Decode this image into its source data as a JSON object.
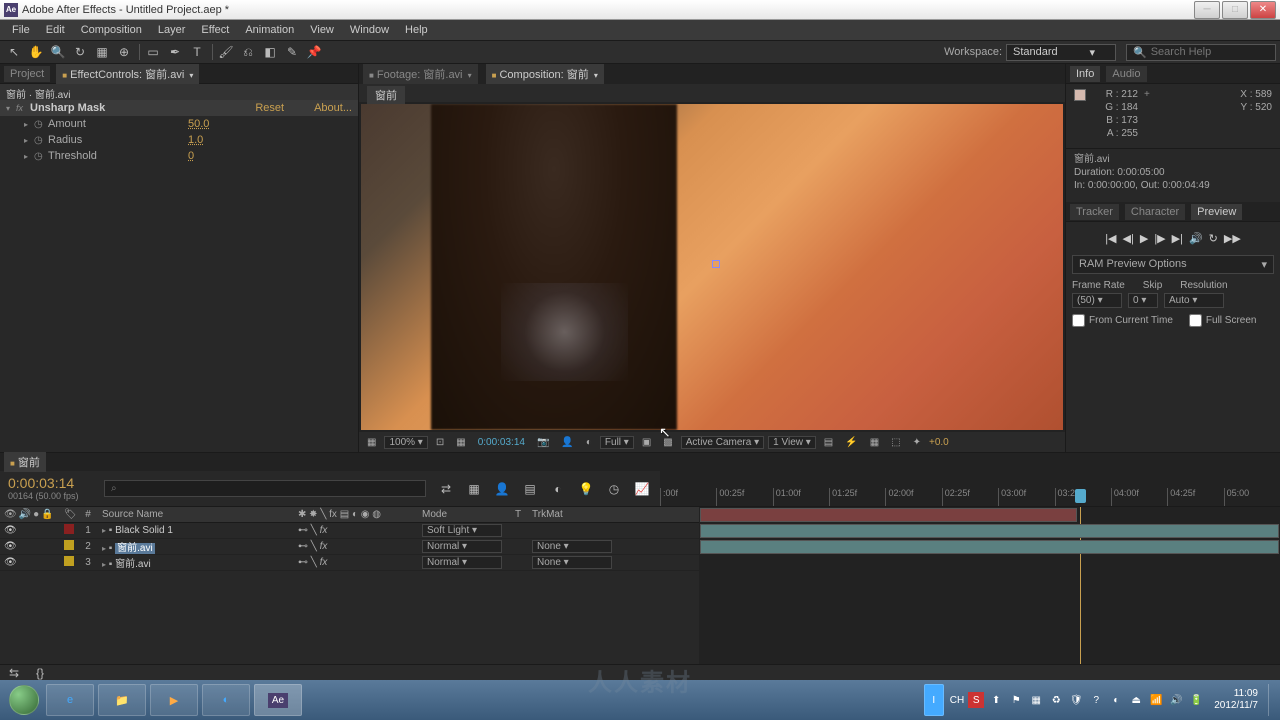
{
  "title_bar": {
    "icon_text": "Ae",
    "title": "Adobe After Effects - Untitled Project.aep *"
  },
  "menu": [
    "File",
    "Edit",
    "Composition",
    "Layer",
    "Effect",
    "Animation",
    "View",
    "Window",
    "Help"
  ],
  "workspace": {
    "label": "Workspace:",
    "value": "Standard"
  },
  "search": {
    "placeholder": "Search Help"
  },
  "left_tabs": {
    "project": "Project",
    "effect_controls": "EffectControls: 窗前.avi"
  },
  "effect_header": "窗前 · 窗前.avi",
  "effect": {
    "name": "Unsharp Mask",
    "reset": "Reset",
    "about": "About...",
    "props": [
      {
        "name": "Amount",
        "value": "50.0"
      },
      {
        "name": "Radius",
        "value": "1.0"
      },
      {
        "name": "Threshold",
        "value": "0"
      }
    ]
  },
  "viewer_tabs": {
    "footage": "Footage: 窗前.avi",
    "composition": "Composition: 窗前"
  },
  "crumb": "窗前",
  "viewer_controls": {
    "zoom": "100%",
    "time": "0:00:03:14",
    "resolution": "Full",
    "camera": "Active Camera",
    "view": "1 View",
    "exposure": "+0.0"
  },
  "info_panel": {
    "tabs": [
      "Info",
      "Audio"
    ],
    "R": "R : 212",
    "G": "G : 184",
    "B": "B : 173",
    "A": "A : 255",
    "X": "X : 589",
    "Y": "Y : 520",
    "asset_name": "窗前.avi",
    "duration": "Duration: 0:00:05:00",
    "inout": "In: 0:00:00:00, Out: 0:00:04:49"
  },
  "right_tabs2": [
    "Tracker",
    "Character",
    "Preview"
  ],
  "preview": {
    "ram_label": "RAM Preview Options",
    "frame_rate_label": "Frame Rate",
    "skip_label": "Skip",
    "resolution_label": "Resolution",
    "frame_rate": "(50)",
    "skip": "0",
    "resolution": "Auto",
    "from_current": "From Current Time",
    "full_screen": "Full Screen"
  },
  "timeline": {
    "tab": "窗前",
    "time": "0:00:03:14",
    "frame_info": "00164 (50.00 fps)",
    "search_icon": "⌕",
    "cols": {
      "num": "#",
      "source": "Source Name",
      "mode": "Mode",
      "t": "T",
      "trkmat": "TrkMat"
    },
    "ticks": [
      ":00f",
      "00:25f",
      "01:00f",
      "01:25f",
      "02:00f",
      "02:25f",
      "03:00f",
      "03:25f",
      "04:00f",
      "04:25f",
      "05:00"
    ],
    "layers": [
      {
        "num": "1",
        "name": "Black Solid 1",
        "color": "#8a2020",
        "mode": "Soft Light",
        "trkmat": ""
      },
      {
        "num": "2",
        "name": "窗前.avi",
        "color": "#c0a020",
        "mode": "Normal",
        "trkmat": "None",
        "selected": true
      },
      {
        "num": "3",
        "name": "窗前.avi",
        "color": "#c0a020",
        "mode": "Normal",
        "trkmat": "None"
      }
    ]
  },
  "taskbar": {
    "clock_time": "11:09",
    "clock_date": "2012/11/7",
    "lang": "CH"
  },
  "watermark": "人人素材"
}
